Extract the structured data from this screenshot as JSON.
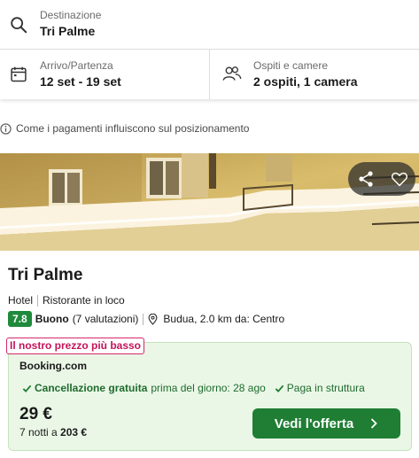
{
  "search": {
    "destination_label": "Destinazione",
    "destination_value": "Tri Palme",
    "dates_label": "Arrivo/Partenza",
    "dates_value": "12 set - 19 set",
    "guests_label": "Ospiti e camere",
    "guests_value": "2 ospiti, 1 camera"
  },
  "info_note": "Come i pagamenti influiscono sul posizionamento",
  "hotel": {
    "name": "Tri Palme",
    "type": "Hotel",
    "feature": "Ristorante in loco",
    "score": "7.8",
    "rating_word": "Buono",
    "reviews": "(7 valutazioni)",
    "location": "Budua, 2.0 km da: Centro"
  },
  "deal": {
    "badge": "Il nostro prezzo più basso",
    "provider": "Booking.com",
    "perk1_strong": "Cancellazione gratuita",
    "perk1_light": "prima del giorno: 28 ago",
    "perk2": "Paga in struttura",
    "price": "29 €",
    "nights_text": "7 notti a",
    "total": "203 €",
    "cta": "Vedi l'offerta"
  },
  "colors": {
    "accent_green": "#1f7e34",
    "deal_bg": "#eaf7e6",
    "badge_pink": "#c4135a"
  },
  "icons": {
    "destination": "search-icon",
    "dates": "calendar-icon",
    "guests": "users-icon",
    "info": "info-icon",
    "share": "share-icon",
    "favorite": "heart-icon",
    "location": "map-pin-icon"
  }
}
